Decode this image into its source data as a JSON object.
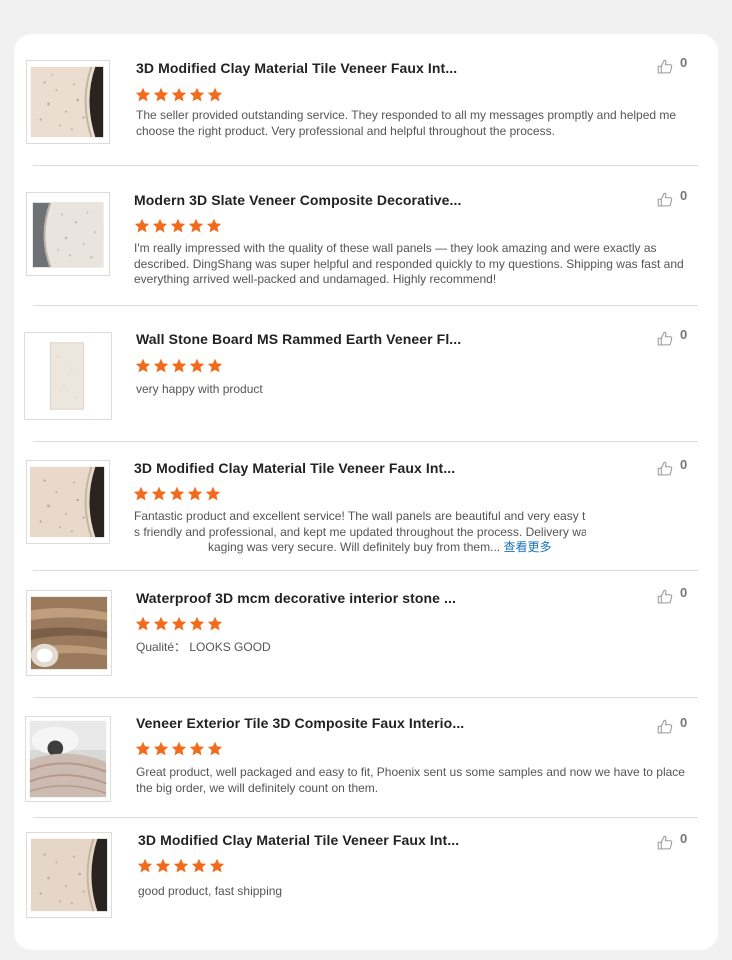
{
  "reviews": [
    {
      "title": "3D Modified Clay Material Tile Veneer Faux Int...",
      "text": "The seller provided outstanding service. They responded to all my messages promptly and helped me choose the right product. Very professional and helpful throughout the process.",
      "rating": 5,
      "likes": "0"
    },
    {
      "title": "Modern 3D Slate Veneer Composite Decorative...",
      "text": "I'm really impressed with the quality of these wall panels — they look amazing and were exactly as described. DingShang was super helpful and responded quickly to my questions. Shipping was fast and everything arrived well-packed and undamaged. Highly recommend!",
      "rating": 5,
      "likes": "0"
    },
    {
      "title": "Wall Stone Board MS Rammed Earth Veneer Fl...",
      "text": "very happy with product",
      "rating": 5,
      "likes": "0"
    },
    {
      "title": "3D Modified Clay Material Tile Veneer Faux Int...",
      "text_line1": "Fantastic product and excellent service! The wall panels are beautiful and very easy to",
      "text_line2": "s friendly and professional, and kept me updated throughout the process. Delivery wa",
      "text_line3": "kaging was very secure. Will definitely buy from them...",
      "more_label": "查看更多",
      "rating": 5,
      "likes": "0"
    },
    {
      "title": "Waterproof 3D mcm decorative interior stone ...",
      "text": "Qualité： LOOKS GOOD",
      "rating": 5,
      "likes": "0"
    },
    {
      "title": "Veneer Exterior Tile 3D Composite Faux Interio...",
      "text": "Great product, well packaged and easy to fit, Phoenix sent us some samples and now we have to place the big order, we will definitely count on them.",
      "rating": 5,
      "likes": "0"
    },
    {
      "title": "3D Modified Clay Material Tile Veneer Faux Int...",
      "text": "good product, fast shipping",
      "rating": 5,
      "likes": "0"
    }
  ],
  "colors": {
    "star": "#f26b1d",
    "link": "#1a73b8",
    "text": "#555555",
    "title": "#222222"
  },
  "icons": {
    "like": "thumbs-up-icon",
    "star": "star-icon"
  }
}
